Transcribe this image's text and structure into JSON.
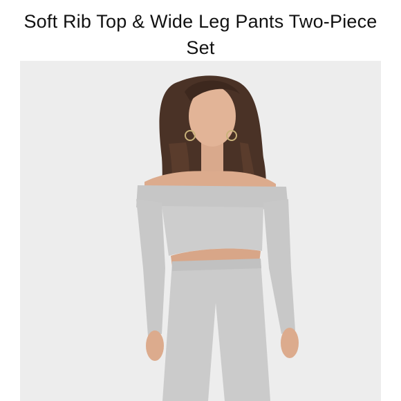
{
  "product": {
    "title": "Soft Rib Top & Wide Leg Pants Two-Piece Set"
  },
  "image": {
    "subject": "model-wearing-grey-ribbed-set",
    "background_color": "#ededed",
    "garment_color": "#c9c9c9"
  }
}
